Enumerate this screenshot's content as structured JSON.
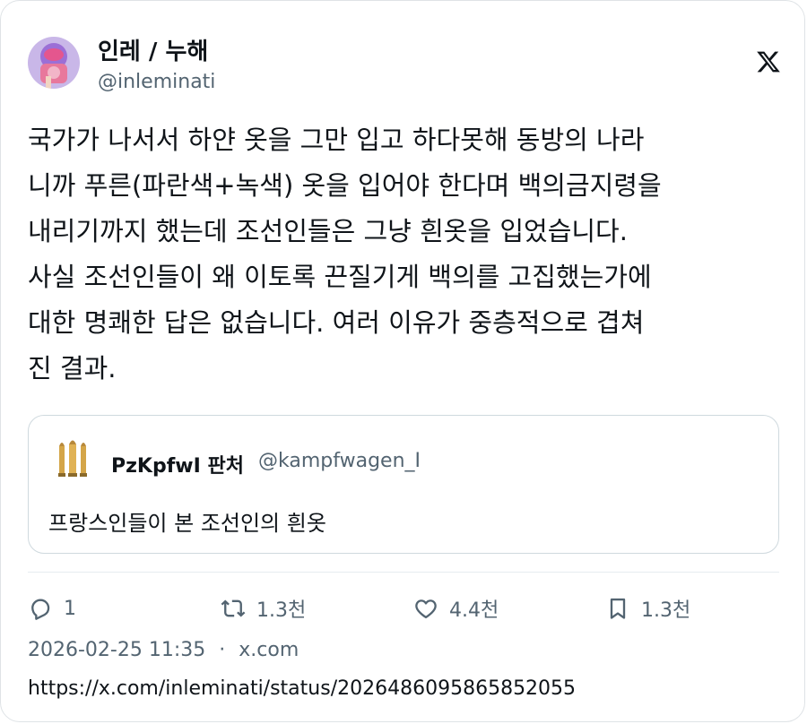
{
  "author": {
    "display_name": "인레 / 누해",
    "handle": "@inleminati",
    "avatar_icon": "profile-avatar"
  },
  "platform_icon": "x-logo-icon",
  "tweet": {
    "lines": [
      "국가가 나서서 하얀 옷을 그만 입고 하다못해 동방의 나라",
      "니까 푸른(파란색+녹색) 옷을 입어야 한다며 백의금지령을",
      "내리기까지 했는데 조선인들은 그냥 흰옷을 입었습니다.",
      "사실 조선인들이 왜 이토록 끈질기게 백의를 고집했는가에",
      "대한 명쾌한 답은 없습니다. 여러 이유가 중층적으로 겹쳐",
      "진 결과."
    ]
  },
  "quote": {
    "display_name": "PzKpfwI 판처",
    "handle": "@kampfwagen_I",
    "text": "프랑스인들이 본 조선인의 흰옷",
    "avatar_icon": "bullets-avatar"
  },
  "actions": {
    "reply_count": "1",
    "retweet_count": "1.3천",
    "like_count": "4.4천",
    "bookmark_count": "1.3천"
  },
  "meta": {
    "timestamp": "2026-02-25 11:35",
    "separator": "·",
    "source": "x.com",
    "url": "https://x.com/inleminati/status/2026486095865852055"
  }
}
